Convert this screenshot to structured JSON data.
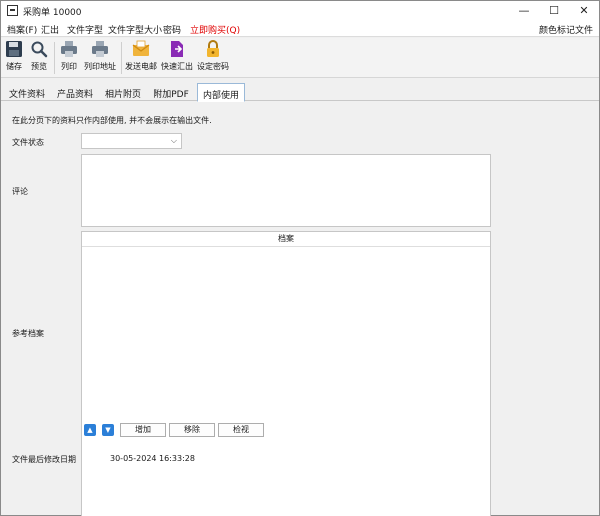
{
  "window": {
    "title": "采购单 10000",
    "minimize": "—",
    "maximize": "☐",
    "close": "✕"
  },
  "menu": {
    "items": [
      "档案(F)",
      "汇出",
      "文件字型",
      "文件字型大小",
      "密码"
    ],
    "special": "立即购买(Q)",
    "right": "颜色标记文件",
    "special_color": "#e00000"
  },
  "toolbar": {
    "items": [
      {
        "label": "储存",
        "icon": "save-icon"
      },
      {
        "label": "预览",
        "icon": "magnifier-icon"
      },
      {
        "label": "列印",
        "icon": "printer-icon"
      },
      {
        "label": "列印地址",
        "icon": "printer-address-icon"
      },
      {
        "label": "发送电邮",
        "icon": "envelope-icon"
      },
      {
        "label": "快速汇出",
        "icon": "export-document-icon"
      },
      {
        "label": "设定密码",
        "icon": "padlock-icon"
      }
    ]
  },
  "tabs": {
    "items": [
      "文件资料",
      "产品资料",
      "相片附页",
      "附加PDF",
      "内部使用"
    ],
    "active": "内部使用"
  },
  "content": {
    "intro": "在此分页下的资料只作内部使用, 并不会展示在输出文件.",
    "status_label": "文件状态",
    "status_value": "",
    "comment_label": "评论",
    "reference_label": "参考档案",
    "file_column_header": "档案",
    "up_label": "▲",
    "down_label": "▼",
    "add_button": "增加",
    "remove_button": "移除",
    "view_button": "检视",
    "last_modified_label": "文件最后修改日期",
    "last_modified_value": "30-05-2024 16:33:28"
  },
  "colors": {
    "accent_blue": "#2b7fd8",
    "tab_border": "#9ab9d8"
  }
}
